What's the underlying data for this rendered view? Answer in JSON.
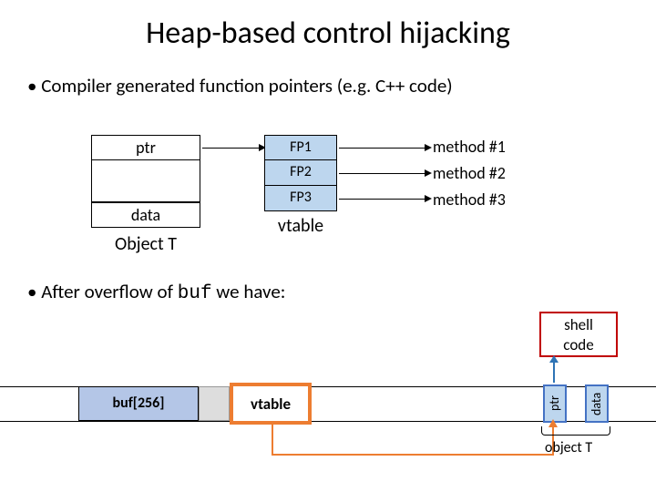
{
  "title": "Heap-based control hijacking",
  "bullet1": "Compiler generated function pointers   (e.g.  C++ code)",
  "object": {
    "ptr": "ptr",
    "data": "data",
    "label": "Object  T"
  },
  "vtable": {
    "fp1": "FP1",
    "fp2": "FP2",
    "fp3": "FP3",
    "label": "vtable"
  },
  "methods": {
    "m1": "method #1",
    "m2": "method #2",
    "m3": "method #3"
  },
  "bullet2_pre": "After overflow of ",
  "bullet2_code": "buf",
  "bullet2_post": " we have:",
  "overflow": {
    "buf": "buf[256]",
    "vtable": "vtable",
    "ptr": "ptr",
    "data": "data",
    "shell1": "shell",
    "shell2": "code",
    "objlabel": "object T"
  }
}
